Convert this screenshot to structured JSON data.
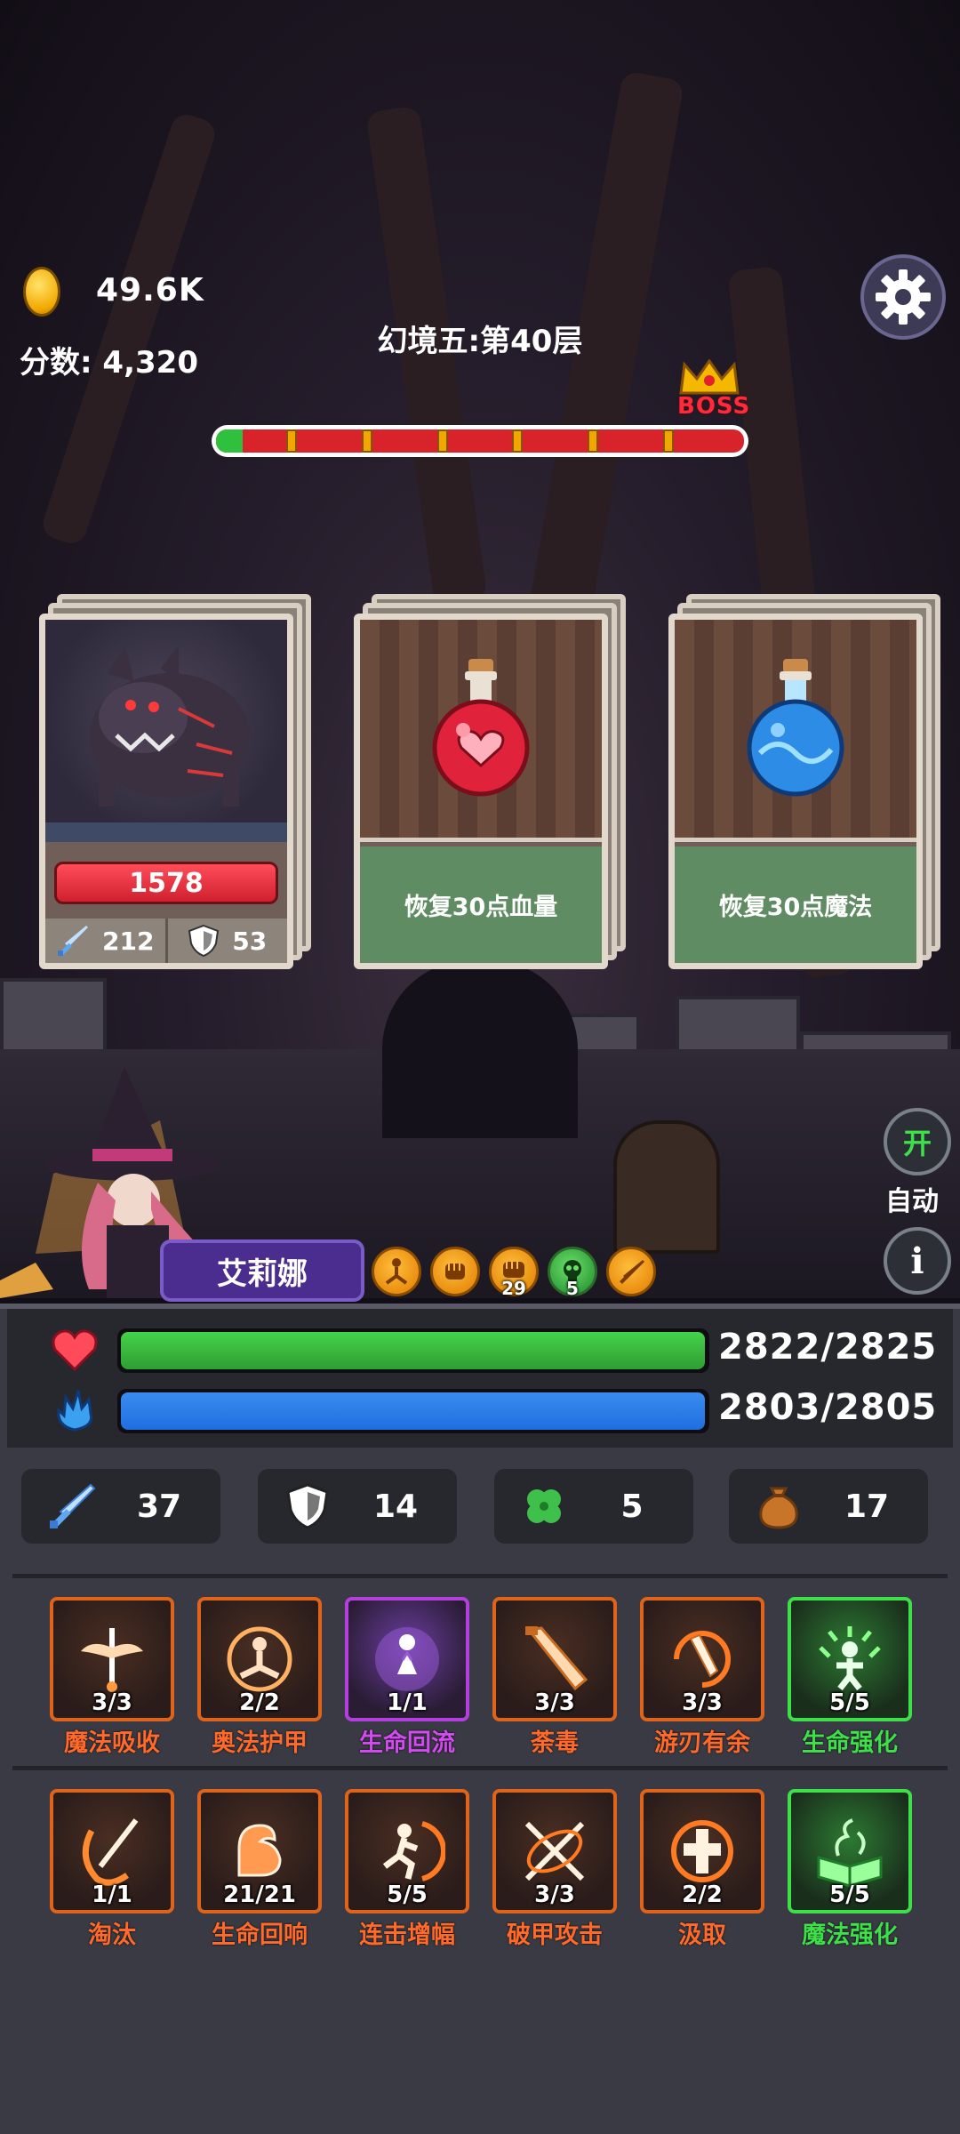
{
  "hud": {
    "gold": "49.6K",
    "score_text": "分数: 4,320",
    "level_title": "幻境五:第40层",
    "boss_label": "BOSS",
    "stage_progress": 0.05,
    "stage_ticks": 6
  },
  "cards": [
    {
      "type": "monster",
      "hp": "1578",
      "attack": "212",
      "defense": "53"
    },
    {
      "type": "potion",
      "potion_color": "#e0233a",
      "description": "恢复30点血量"
    },
    {
      "type": "potion",
      "potion_color": "#2d8ce6",
      "description": "恢复30点魔法"
    }
  ],
  "hero": {
    "name": "艾莉娜",
    "buffs": [
      {
        "icon": "yoga-buff-icon",
        "count": "",
        "color": "orange"
      },
      {
        "icon": "fist-buff-icon",
        "count": "",
        "color": "orange"
      },
      {
        "icon": "power-fist-buff-icon",
        "count": "29",
        "color": "orange"
      },
      {
        "icon": "poison-skull-buff-icon",
        "count": "5",
        "color": "green"
      },
      {
        "icon": "sword-buff-icon",
        "count": "",
        "color": "orange"
      }
    ],
    "toggle_label": "开",
    "auto_label": "自动",
    "info_label": "i"
  },
  "status": {
    "hp_text": "2822/2825",
    "hp_ratio": 0.999,
    "hp_color": "#45d24a",
    "mp_text": "2803/2805",
    "mp_ratio": 0.999,
    "mp_color": "#1f6ee0"
  },
  "stats": [
    {
      "icon": "sword-icon",
      "value": "37"
    },
    {
      "icon": "shield-icon",
      "value": "14"
    },
    {
      "icon": "clover-icon",
      "value": "5"
    },
    {
      "icon": "money-bag-icon",
      "value": "17"
    }
  ],
  "skills_row1": [
    {
      "name": "魔法吸收",
      "level": "3/3",
      "rarity": "orange",
      "icon": "winged-sword-icon"
    },
    {
      "name": "奥法护甲",
      "level": "2/2",
      "rarity": "orange",
      "icon": "meditation-icon"
    },
    {
      "name": "生命回流",
      "level": "1/1",
      "rarity": "purple",
      "icon": "praying-figure-icon"
    },
    {
      "name": "荼毒",
      "level": "3/3",
      "rarity": "orange",
      "icon": "blade-icon"
    },
    {
      "name": "游刃有余",
      "level": "3/3",
      "rarity": "orange",
      "icon": "spinning-blade-icon"
    },
    {
      "name": "生命强化",
      "level": "5/5",
      "rarity": "green",
      "icon": "vitality-figure-icon"
    }
  ],
  "skills_row2": [
    {
      "name": "淘汰",
      "level": "1/1",
      "rarity": "orange",
      "icon": "slash-icon"
    },
    {
      "name": "生命回响",
      "level": "21/21",
      "rarity": "orange",
      "icon": "flex-arm-icon"
    },
    {
      "name": "连击增幅",
      "level": "5/5",
      "rarity": "orange",
      "icon": "running-figure-icon"
    },
    {
      "name": "破甲攻击",
      "level": "3/3",
      "rarity": "orange",
      "icon": "crossed-arrows-icon"
    },
    {
      "name": "汲取",
      "level": "2/2",
      "rarity": "orange",
      "icon": "holy-cross-icon"
    },
    {
      "name": "魔法强化",
      "level": "5/5",
      "rarity": "green",
      "icon": "spellbook-icon"
    }
  ]
}
